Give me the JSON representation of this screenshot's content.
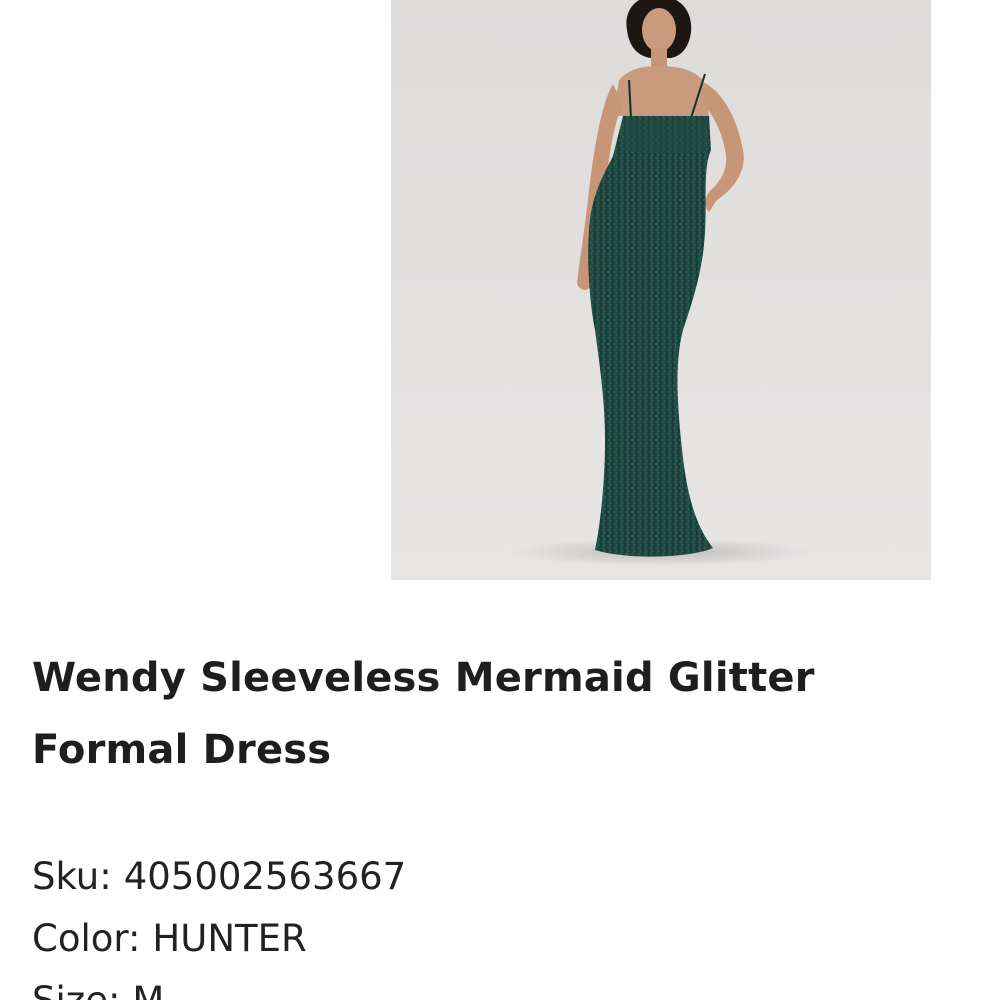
{
  "product": {
    "image_alt": "model wearing a hunter green glitter mermaid gown",
    "title": "Wendy Sleeveless Mermaid Glitter Formal Dress",
    "details": [
      {
        "label": "Sku:",
        "value": "405002563667"
      },
      {
        "label": "Color:",
        "value": "HUNTER"
      },
      {
        "label": "Size:",
        "value": "M"
      }
    ]
  },
  "colors": {
    "dress": "#1f4a42",
    "background_photo": "#e1dfde",
    "text": "#1e1e1e"
  }
}
